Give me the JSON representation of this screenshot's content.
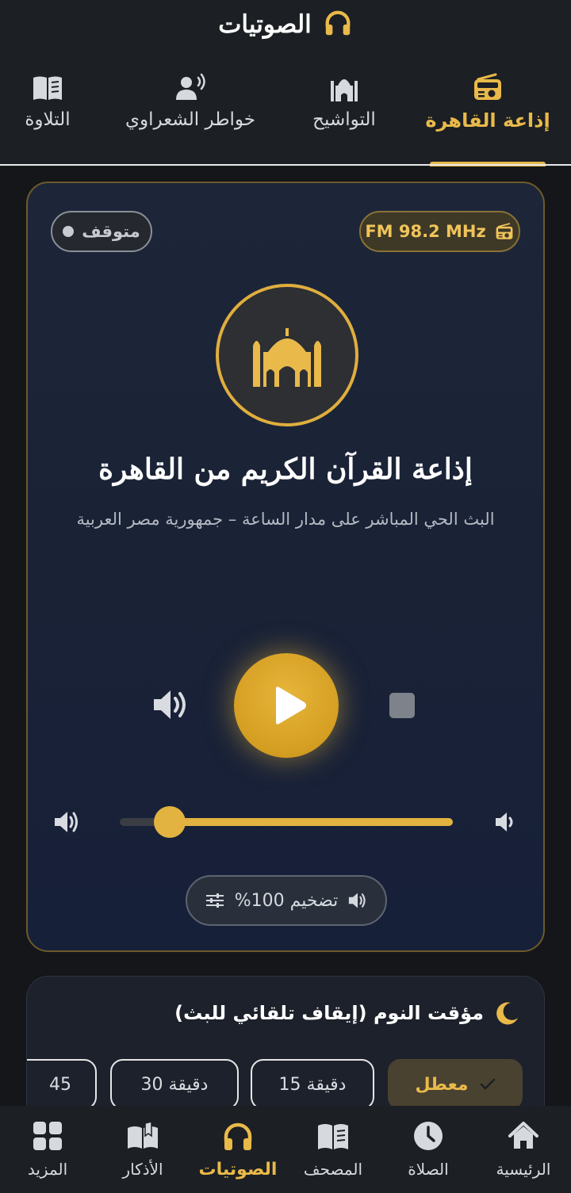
{
  "header": {
    "title": "الصوتيات",
    "icon": "headphones-icon"
  },
  "top_tabs": [
    {
      "label": "إذاعة القاهرة",
      "icon": "radio-icon",
      "active": true
    },
    {
      "label": "التواشيح",
      "icon": "mosque-icon",
      "active": false
    },
    {
      "label": "خواطر الشعراوي",
      "icon": "speaker-person-icon",
      "active": false
    },
    {
      "label": "التلاوة",
      "icon": "book-icon",
      "active": false
    }
  ],
  "radio": {
    "status": "متوقف",
    "frequency": "FM 98.2 MHz",
    "station_name": "إذاعة القرآن الكريم من القاهرة",
    "station_description": "البث الحي المباشر على مدار الساعة – جمهورية مصر العربية",
    "volume_fraction": 0.15,
    "boost_label": "تضخيم 100%"
  },
  "sleep_timer": {
    "title": "مؤقت النوم (إيقاف تلقائي للبث)",
    "options": [
      {
        "label": "معطل",
        "selected": true
      },
      {
        "label": "15 دقيقة",
        "selected": false
      },
      {
        "label": "30 دقيقة",
        "selected": false
      },
      {
        "label": "45",
        "selected": false
      }
    ]
  },
  "bottom_nav": [
    {
      "label": "الرئيسية",
      "icon": "home-icon",
      "active": false
    },
    {
      "label": "الصلاة",
      "icon": "clock-icon",
      "active": false
    },
    {
      "label": "المصحف",
      "icon": "book-icon",
      "active": false
    },
    {
      "label": "الصوتيات",
      "icon": "headphones-icon",
      "active": true
    },
    {
      "label": "الأذكار",
      "icon": "open-book-icon",
      "active": false
    },
    {
      "label": "المزيد",
      "icon": "grid-icon",
      "active": false
    }
  ],
  "colors": {
    "accent": "#e9b94a",
    "background": "#141619",
    "card": "#1d2639"
  }
}
